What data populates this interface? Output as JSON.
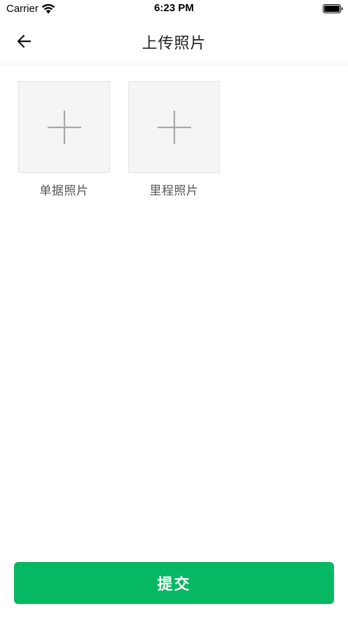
{
  "status_bar": {
    "carrier": "Carrier",
    "time": "6:23 PM",
    "icons": [
      "wifi-icon",
      "battery-icon"
    ]
  },
  "nav": {
    "title": "上传照片",
    "back_icon": "arrow-left-icon"
  },
  "uploads": [
    {
      "label": "单据照片",
      "icon": "plus-icon"
    },
    {
      "label": "里程照片",
      "icon": "plus-icon"
    }
  ],
  "submit_label": "提交",
  "colors": {
    "accent": "#07b862",
    "tile_bg": "#f5f5f5",
    "plus": "#a8a8a8"
  }
}
